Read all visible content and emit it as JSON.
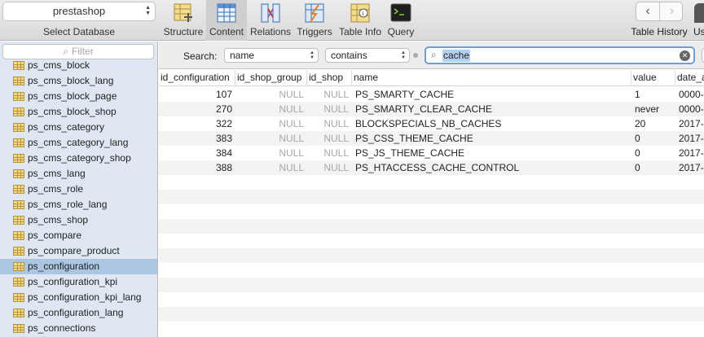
{
  "toolbar": {
    "database": "prestashop",
    "database_label": "Select Database",
    "buttons": [
      {
        "label": "Structure"
      },
      {
        "label": "Content"
      },
      {
        "label": "Relations"
      },
      {
        "label": "Triggers"
      },
      {
        "label": "Table Info"
      },
      {
        "label": "Query"
      }
    ],
    "history_label": "Table History",
    "user_label": "Us"
  },
  "sidebar": {
    "filter_placeholder": "Filter",
    "tables": [
      "ps_cms_block",
      "ps_cms_block_lang",
      "ps_cms_block_page",
      "ps_cms_block_shop",
      "ps_cms_category",
      "ps_cms_category_lang",
      "ps_cms_category_shop",
      "ps_cms_lang",
      "ps_cms_role",
      "ps_cms_role_lang",
      "ps_cms_shop",
      "ps_compare",
      "ps_compare_product",
      "ps_configuration",
      "ps_configuration_kpi",
      "ps_configuration_kpi_lang",
      "ps_configuration_lang",
      "ps_connections"
    ],
    "selected": "ps_configuration"
  },
  "search": {
    "label": "Search:",
    "field": "name",
    "operator": "contains",
    "value": "cache"
  },
  "grid": {
    "columns": [
      "id_configuration",
      "id_shop_group",
      "id_shop",
      "name",
      "value",
      "date_a"
    ],
    "rows": [
      [
        "107",
        "NULL",
        "NULL",
        "PS_SMARTY_CACHE",
        "1",
        "0000-"
      ],
      [
        "270",
        "NULL",
        "NULL",
        "PS_SMARTY_CLEAR_CACHE",
        "never",
        "0000-"
      ],
      [
        "322",
        "NULL",
        "NULL",
        "BLOCKSPECIALS_NB_CACHES",
        "20",
        "2017-"
      ],
      [
        "383",
        "NULL",
        "NULL",
        "PS_CSS_THEME_CACHE",
        "0",
        "2017-"
      ],
      [
        "384",
        "NULL",
        "NULL",
        "PS_JS_THEME_CACHE",
        "0",
        "2017-"
      ],
      [
        "388",
        "NULL",
        "NULL",
        "PS_HTACCESS_CACHE_CONTROL",
        "0",
        "2017-"
      ]
    ]
  },
  "colors": {
    "accent": "#6ea0d6",
    "selection": "#aac6e2",
    "sidebar_bg": "#dfe8f2",
    "null_text": "#a8a8a8"
  }
}
